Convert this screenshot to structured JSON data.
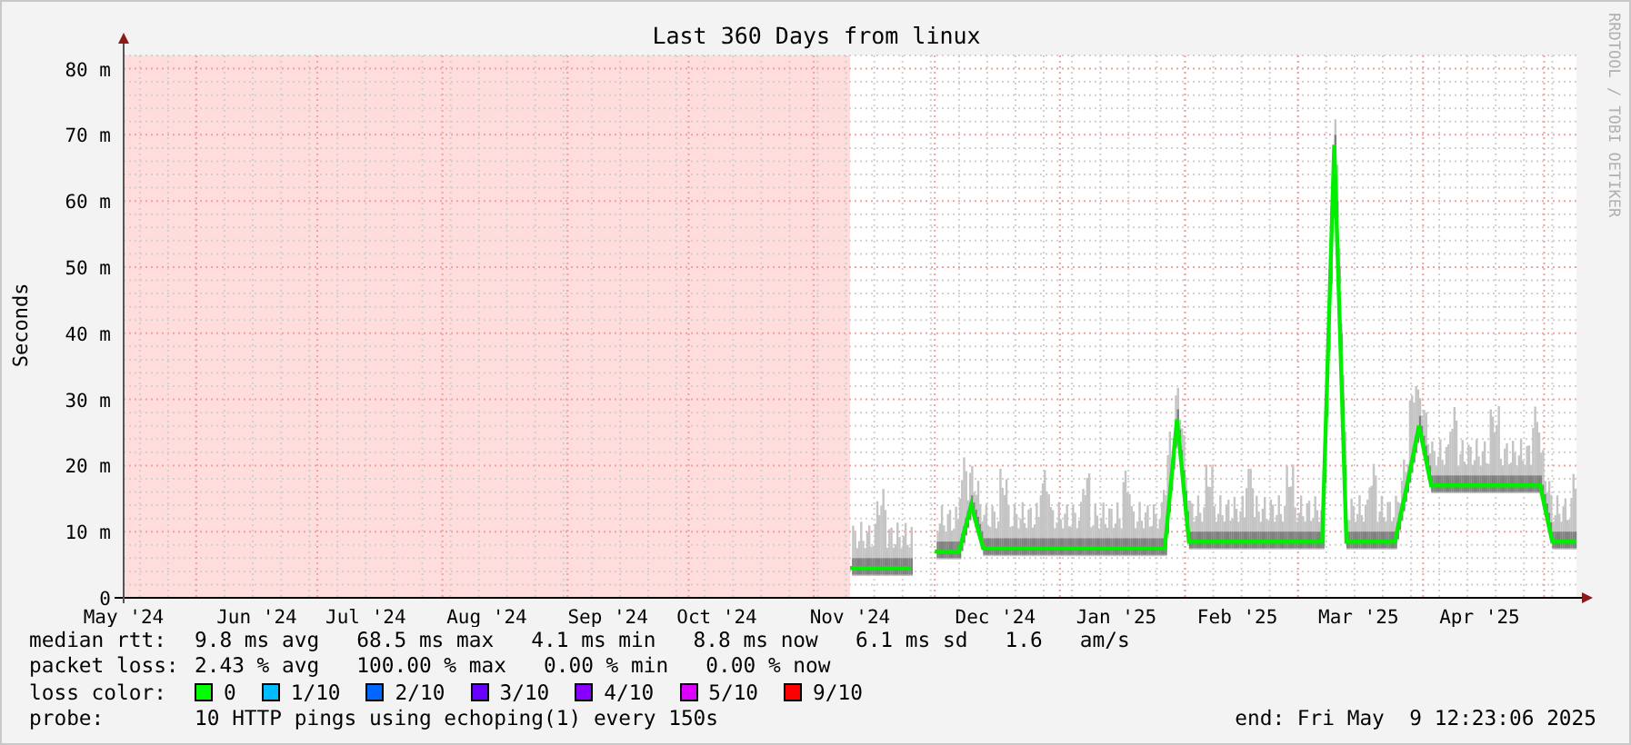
{
  "chart": {
    "side_label": "RRDTOOL / TOBI OETIKER",
    "chart_data": {
      "type": "line",
      "grid": true,
      "title": "Last 360 Days from linux",
      "ylabel": "Seconds",
      "ylim": [
        0,
        82
      ],
      "categories": [
        "May '24",
        null,
        null,
        null,
        null,
        null,
        null,
        null,
        null,
        null,
        null,
        "Jun '24",
        null,
        null,
        null,
        null,
        null,
        null,
        null,
        null,
        "Jul '24",
        null,
        null,
        null,
        null,
        null,
        null,
        null,
        null,
        null,
        "Aug '24",
        null,
        null,
        null,
        null,
        null,
        null,
        null,
        null,
        null,
        "Sep '24",
        null,
        null,
        null,
        null,
        null,
        null,
        null,
        null,
        "Oct '24",
        null,
        null,
        null,
        null,
        null,
        null,
        null,
        null,
        null,
        null,
        "Nov '24",
        null,
        null,
        null,
        null,
        null,
        null,
        null,
        null,
        null,
        null,
        null,
        "Dec '24",
        null,
        null,
        null,
        null,
        null,
        null,
        null,
        null,
        null,
        "Jan '25",
        null,
        null,
        null,
        null,
        null,
        null,
        null,
        null,
        null,
        "Feb '25",
        null,
        null,
        null,
        null,
        null,
        null,
        null,
        null,
        null,
        "Mar '25",
        null,
        null,
        null,
        null,
        null,
        null,
        null,
        null,
        null,
        "Apr '25",
        null,
        null,
        null,
        null,
        null,
        null,
        null,
        null
      ],
      "yticks": [
        {
          "value": 0,
          "label": "0"
        },
        {
          "value": 10,
          "label": "10 m"
        },
        {
          "value": 20,
          "label": "20 m"
        },
        {
          "value": 30,
          "label": "30 m"
        },
        {
          "value": 40,
          "label": "40 m"
        },
        {
          "value": 50,
          "label": "50 m"
        },
        {
          "value": 60,
          "label": "60 m"
        },
        {
          "value": 70,
          "label": "70 m"
        },
        {
          "value": 80,
          "label": "80 m"
        }
      ],
      "series": [
        {
          "color": "#00ee00",
          "values": [
            null,
            null,
            null,
            null,
            null,
            null,
            null,
            null,
            null,
            null,
            null,
            null,
            null,
            null,
            null,
            null,
            null,
            null,
            null,
            null,
            null,
            null,
            null,
            null,
            null,
            null,
            null,
            null,
            null,
            null,
            null,
            null,
            null,
            null,
            null,
            null,
            null,
            null,
            null,
            null,
            null,
            null,
            null,
            null,
            null,
            null,
            null,
            null,
            null,
            null,
            null,
            null,
            null,
            null,
            null,
            null,
            null,
            null,
            null,
            null,
            4.5,
            4.5,
            4.5,
            4.5,
            4.5,
            4.5,
            null,
            7,
            7,
            7,
            14,
            7.5,
            7.5,
            7.5,
            7.5,
            7.5,
            7.5,
            7.5,
            7.5,
            7.5,
            7.5,
            7.5,
            7.5,
            7.5,
            7.5,
            7.5,
            7.5,
            27,
            8.5,
            8.5,
            8.5,
            8.5,
            8.5,
            8.5,
            8.5,
            8.5,
            8.5,
            8.5,
            8.5,
            8.5,
            68.5,
            8.5,
            8.5,
            8.5,
            8.5,
            8.5,
            17,
            26,
            17,
            17,
            17,
            17,
            17,
            17,
            17,
            17,
            17,
            17,
            8.5,
            8.5,
            8.5
          ]
        }
      ]
    },
    "loss_region": {
      "color": "#ffdddd"
    }
  },
  "legend": {
    "rows": [
      {
        "label": "median rtt:",
        "value": "9.8 ms avg   68.5 ms max   4.1 ms min   8.8 ms now   6.1 ms sd   1.6   am/s"
      },
      {
        "label": "packet loss:",
        "value": "2.43 % avg   100.00 % max   0.00 % min   0.00 % now"
      }
    ],
    "loss_color": {
      "label": "loss color:",
      "items": [
        {
          "label": "0",
          "color": "#00ff00"
        },
        {
          "label": "1/10",
          "color": "#00bbff"
        },
        {
          "label": "2/10",
          "color": "#0066ff"
        },
        {
          "label": "3/10",
          "color": "#6600ff"
        },
        {
          "label": "4/10",
          "color": "#8800ff"
        },
        {
          "label": "5/10",
          "color": "#dd00ff"
        },
        {
          "label": "9/10",
          "color": "#ff0000"
        }
      ]
    },
    "probe": {
      "label": "probe:",
      "value": "10 HTTP pings using echoping(1) every 150s"
    },
    "end": "end: Fri May  9 12:23:06 2025"
  }
}
